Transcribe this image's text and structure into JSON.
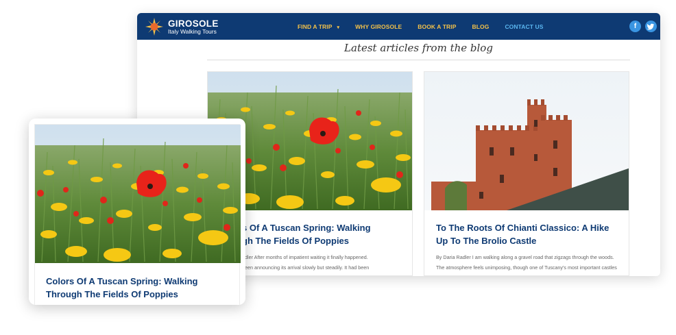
{
  "brand": {
    "name": "GIROSOLE",
    "tagline": "Italy Walking Tours"
  },
  "nav": {
    "items": [
      {
        "label": "FIND A TRIP",
        "has_dropdown": true
      },
      {
        "label": "WHY GIROSOLE"
      },
      {
        "label": "BOOK A TRIP"
      },
      {
        "label": "BLOG"
      },
      {
        "label": "CONTACT US"
      }
    ],
    "caret": "▾"
  },
  "social": {
    "facebook": "f",
    "twitter": "t"
  },
  "blog": {
    "heading": "Latest articles from the blog",
    "posts": [
      {
        "title_partial": "s Of A Tuscan Spring: Walking\ngh The Fields Of Poppies",
        "excerpt_partial": "adler After months of impatient waiting it finally happened.\nbeen announcing its arrival slowly but steadily. It had been\nke a Christmas calendar that, instead of chocolate, gave me a",
        "image": "poppy-field"
      },
      {
        "title": "To The Roots Of Chianti Classico: A Hike Up To The Brolio Castle",
        "excerpt": "By Daria Radler I am walking along a gravel road that zigzags through the woods. The atmosphere feels unimposing, though one of Tuscany's most important castles waits at the top of the hill. Here and there, a sign points to",
        "image": "brolio-castle"
      }
    ]
  },
  "featured_card": {
    "title": "Colors Of A Tuscan Spring: Walking Through The Fields Of Poppies",
    "image": "poppy-field"
  },
  "colors": {
    "navy": "#0e3a73",
    "nav_gold": "#f2c14a",
    "nav_blue": "#5bb6f0",
    "social_blue": "#3a95e2"
  }
}
